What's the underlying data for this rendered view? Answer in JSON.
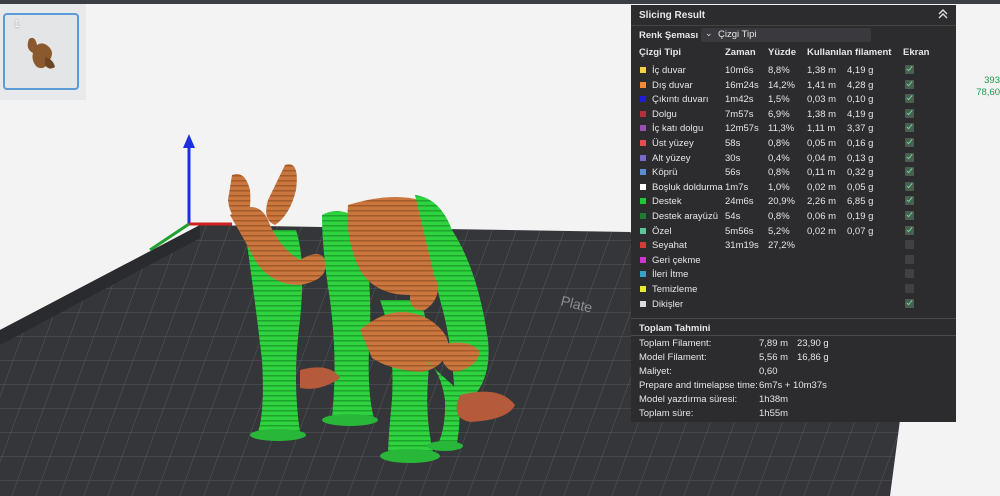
{
  "thumbnail": {
    "number": "1"
  },
  "panel": {
    "title": "Slicing Result",
    "scheme_label": "Renk Şeması",
    "scheme_value": "Çizgi Tipi",
    "headers": {
      "type": "Çizgi Tipi",
      "time": "Zaman",
      "percent": "Yüzde",
      "filament": "Kullanılan filament",
      "display": "Ekran"
    },
    "rows": [
      {
        "label": "İç duvar",
        "color": "#f2d24a",
        "time": "10m6s",
        "percent": "8,8%",
        "meters": "1,38 m",
        "grams": "4,19 g",
        "shown": true
      },
      {
        "label": "Dış duvar",
        "color": "#ee8a3a",
        "time": "16m24s",
        "percent": "14,2%",
        "meters": "1,41 m",
        "grams": "4,28 g",
        "shown": true
      },
      {
        "label": "Çıkıntı duvarı",
        "color": "#1d1de0",
        "time": "1m42s",
        "percent": "1,5%",
        "meters": "0,03 m",
        "grams": "0,10 g",
        "shown": true
      },
      {
        "label": "Dolgu",
        "color": "#b0333b",
        "time": "7m57s",
        "percent": "6,9%",
        "meters": "1,38 m",
        "grams": "4,19 g",
        "shown": true
      },
      {
        "label": "İç katı dolgu",
        "color": "#9b4fb2",
        "time": "12m57s",
        "percent": "11,3%",
        "meters": "1,11 m",
        "grams": "3,37 g",
        "shown": true
      },
      {
        "label": "Üst yüzey",
        "color": "#e05050",
        "time": "58s",
        "percent": "0,8%",
        "meters": "0,05 m",
        "grams": "0,16 g",
        "shown": true
      },
      {
        "label": "Alt yüzey",
        "color": "#7a6ac8",
        "time": "30s",
        "percent": "0,4%",
        "meters": "0,04 m",
        "grams": "0,13 g",
        "shown": true
      },
      {
        "label": "Köprü",
        "color": "#5c8fd0",
        "time": "56s",
        "percent": "0,8%",
        "meters": "0,11 m",
        "grams": "0,32 g",
        "shown": true
      },
      {
        "label": "Boşluk doldurma",
        "color": "#ffffff",
        "time": "1m7s",
        "percent": "1,0%",
        "meters": "0,02 m",
        "grams": "0,05 g",
        "shown": true
      },
      {
        "label": "Destek",
        "color": "#27c43a",
        "time": "24m6s",
        "percent": "20,9%",
        "meters": "2,26 m",
        "grams": "6,85 g",
        "shown": true
      },
      {
        "label": "Destek arayüzü",
        "color": "#1f7a32",
        "time": "54s",
        "percent": "0,8%",
        "meters": "0,06 m",
        "grams": "0,19 g",
        "shown": true
      },
      {
        "label": "Özel",
        "color": "#5ec59a",
        "time": "5m56s",
        "percent": "5,2%",
        "meters": "0,02 m",
        "grams": "0,07 g",
        "shown": true
      },
      {
        "label": "Seyahat",
        "color": "#d83a3a",
        "time": "31m19s",
        "percent": "27,2%",
        "meters": "",
        "grams": "",
        "shown": false
      },
      {
        "label": "Geri çekme",
        "color": "#c83ac8",
        "time": "",
        "percent": "",
        "meters": "",
        "grams": "",
        "shown": false
      },
      {
        "label": "İleri İtme",
        "color": "#3aa0c8",
        "time": "",
        "percent": "",
        "meters": "",
        "grams": "",
        "shown": false
      },
      {
        "label": "Temizleme",
        "color": "#e8e83a",
        "time": "",
        "percent": "",
        "meters": "",
        "grams": "",
        "shown": false
      },
      {
        "label": "Dikişler",
        "color": "#dcdcdc",
        "time": "",
        "percent": "",
        "meters": "",
        "grams": "",
        "shown": true
      }
    ],
    "summary_title": "Toplam Tahmini",
    "summary": [
      {
        "label": "Toplam Filament:",
        "value": "7,89 m",
        "value2": "23,90 g"
      },
      {
        "label": "Model Filament:",
        "value": "5,56 m",
        "value2": "16,86 g"
      },
      {
        "label": "Maliyet:",
        "value": "0,60",
        "value2": ""
      },
      {
        "label": "Prepare and timelapse time:",
        "value": "6m7s + 10m37s",
        "value2": ""
      },
      {
        "label": "Model yazdırma süresi:",
        "value": "1h38m",
        "value2": ""
      },
      {
        "label": "Toplam süre:",
        "value": "1h55m",
        "value2": ""
      }
    ]
  },
  "side_readout": {
    "line1": "393",
    "line2": "78,60"
  },
  "plate_text": "Plate",
  "colors": {
    "support": "#27c43a",
    "outer_wall": "#c9773e",
    "panel_bg": "#2c2c2f",
    "plate": "#3b3d40"
  }
}
